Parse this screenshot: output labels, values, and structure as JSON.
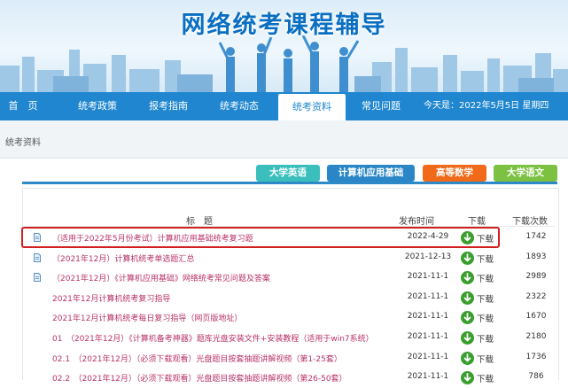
{
  "banner": {
    "title": "网络统考课程辅导"
  },
  "nav": {
    "items": [
      {
        "label": "首　页"
      },
      {
        "label": "统考政策"
      },
      {
        "label": "报考指南"
      },
      {
        "label": "统考动态"
      },
      {
        "label": "统考资料",
        "active": true
      },
      {
        "label": "常见问题"
      }
    ],
    "date_text": "今天是：2022年5月5日 星期四"
  },
  "section": {
    "title": "统考资料"
  },
  "tabs": [
    {
      "label": "大学英语",
      "color": "#3bbfbd"
    },
    {
      "label": "计算机应用基础",
      "color": "#2a86c6"
    },
    {
      "label": "高等数学",
      "color": "#f06a1a"
    },
    {
      "label": "大学语文",
      "color": "#7cc142"
    }
  ],
  "table": {
    "headers": {
      "title": "标　题",
      "date": "发布时间",
      "download": "下载",
      "count": "下载次数"
    },
    "rows": [
      {
        "title": "（适用于2022年5月份考试）计算机应用基础统考复习题",
        "date": "2022-4-29",
        "download": "下载",
        "count": "1742",
        "icon": true,
        "highlighted": true
      },
      {
        "title": "（2021年12月）计算机统考单选题汇总",
        "date": "2021-12-13",
        "download": "下载",
        "count": "1893",
        "icon": true
      },
      {
        "title": "（2021年12月）《计算机应用基础》网络统考常见问题及答案",
        "date": "2021-11-1",
        "download": "下载",
        "count": "2989",
        "icon": true
      },
      {
        "title": "2021年12月计算机统考复习指导",
        "date": "2021-11-1",
        "download": "下载",
        "count": "2322",
        "icon": false
      },
      {
        "title": "2021年12月计算机统考每日复习指导（网页版地址）",
        "date": "2021-11-1",
        "download": "下载",
        "count": "1670",
        "icon": false
      },
      {
        "title": "01　（2021年12月）《计算机备考神器》题库光盘安装文件+安装教程（适用于win7系统）",
        "date": "2021-11-1",
        "download": "下载",
        "count": "2180",
        "icon": false
      },
      {
        "title": "02.1　（2021年12月）（必须下载观看）光盘题目按套抽题讲解视频（第1-25套）",
        "date": "2021-11-1",
        "download": "下载",
        "count": "1736",
        "icon": false
      },
      {
        "title": "02.2　（2021年12月）（必须下载观看）光盘题目按套抽题讲解视频（第26-50套）",
        "date": "2021-11-1",
        "download": "下载",
        "count": "786",
        "icon": false
      }
    ]
  },
  "colors": {
    "nav_bg": "#1f86cf",
    "title_link": "#b8336a",
    "download_green": "#3a9e2e",
    "highlight_border": "#d21f1f"
  }
}
